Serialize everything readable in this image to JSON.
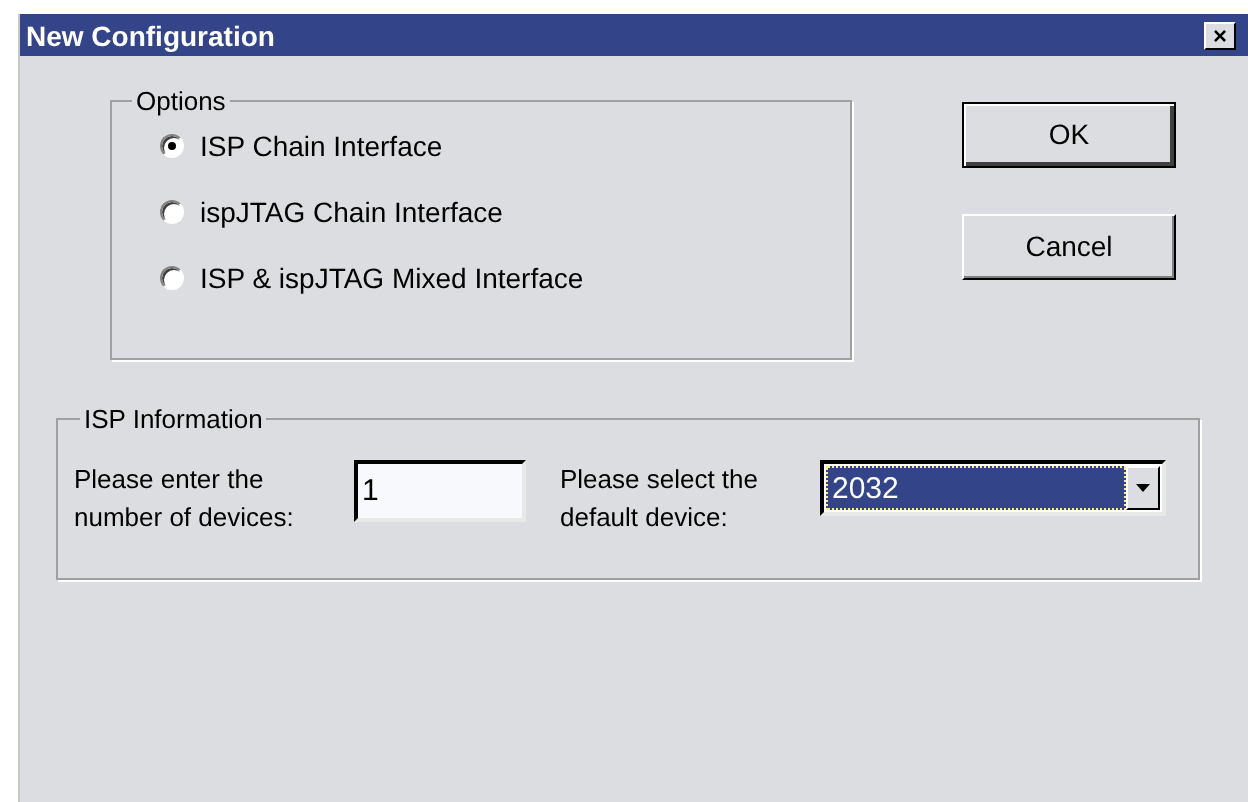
{
  "window": {
    "title": "New Configuration",
    "close": "×"
  },
  "options": {
    "label": "Options",
    "items": [
      {
        "label": "ISP Chain Interface",
        "selected": true
      },
      {
        "label": "ispJTAG Chain Interface",
        "selected": false
      },
      {
        "label": "ISP & ispJTAG Mixed Interface",
        "selected": false
      }
    ]
  },
  "buttons": [
    "OK",
    "Cancel"
  ],
  "isp_information": {
    "label": "ISP Information",
    "devices_label": "Please enter the number of devices:",
    "devices_value": "1",
    "default_label": "Please select the default device:",
    "default_value": "2032"
  }
}
